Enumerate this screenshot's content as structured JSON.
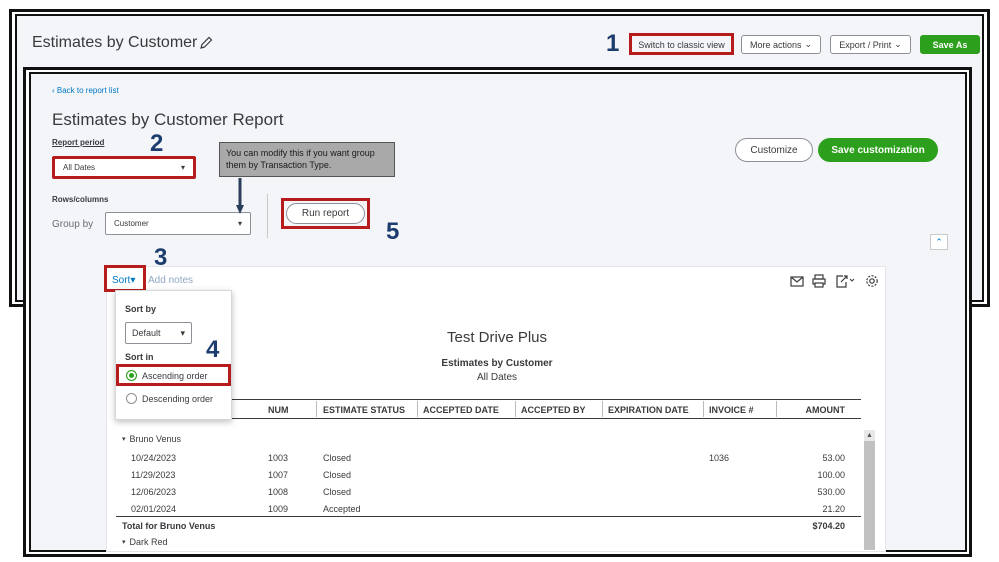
{
  "header": {
    "title": "Estimates by Customer",
    "switch_classic": "Switch to classic view",
    "more_actions": "More actions",
    "export_print": "Export / Print",
    "save_as": "Save As"
  },
  "steps": [
    "1",
    "2",
    "3",
    "4",
    "5"
  ],
  "report_panel": {
    "back_link": "Back to report list",
    "title": "Estimates by Customer Report",
    "report_period_label": "Report period",
    "report_period_value": "All Dates",
    "rows_columns_label": "Rows/columns",
    "group_by_label": "Group by",
    "group_by_value": "Customer",
    "run_report": "Run report",
    "customize": "Customize",
    "save_customization": "Save customization",
    "tooltip": "You can modify this if you want group them by Transaction Type."
  },
  "report": {
    "sort_link": "Sort",
    "add_notes": "Add notes",
    "company": "Test Drive Plus",
    "name": "Estimates by Customer",
    "dates": "All Dates",
    "columns": [
      "NUM",
      "ESTIMATE STATUS",
      "ACCEPTED DATE",
      "ACCEPTED BY",
      "EXPIRATION DATE",
      "INVOICE #",
      "AMOUNT"
    ],
    "group1": "Bruno Venus",
    "rows": [
      {
        "date": "10/24/2023",
        "num": "1003",
        "status": "Closed",
        "invoice": "1036",
        "amount": "53.00"
      },
      {
        "date": "11/29/2023",
        "num": "1007",
        "status": "Closed",
        "invoice": "",
        "amount": "100.00"
      },
      {
        "date": "12/06/2023",
        "num": "1008",
        "status": "Closed",
        "invoice": "",
        "amount": "530.00"
      },
      {
        "date": "02/01/2024",
        "num": "1009",
        "status": "Accepted",
        "invoice": "",
        "amount": "21.20"
      }
    ],
    "total_label": "Total for Bruno Venus",
    "total_amount": "$704.20",
    "group2": "Dark Red"
  },
  "sort_menu": {
    "sort_by_label": "Sort by",
    "sort_by_value": "Default",
    "sort_in_label": "Sort in",
    "ascending": "Ascending order",
    "descending": "Descending order",
    "selected": "ascending"
  },
  "colors": {
    "highlight": "#b71c1c",
    "accent_green": "#2ca01c",
    "link_blue": "#0077c5",
    "step_blue": "#1d3d6e"
  }
}
